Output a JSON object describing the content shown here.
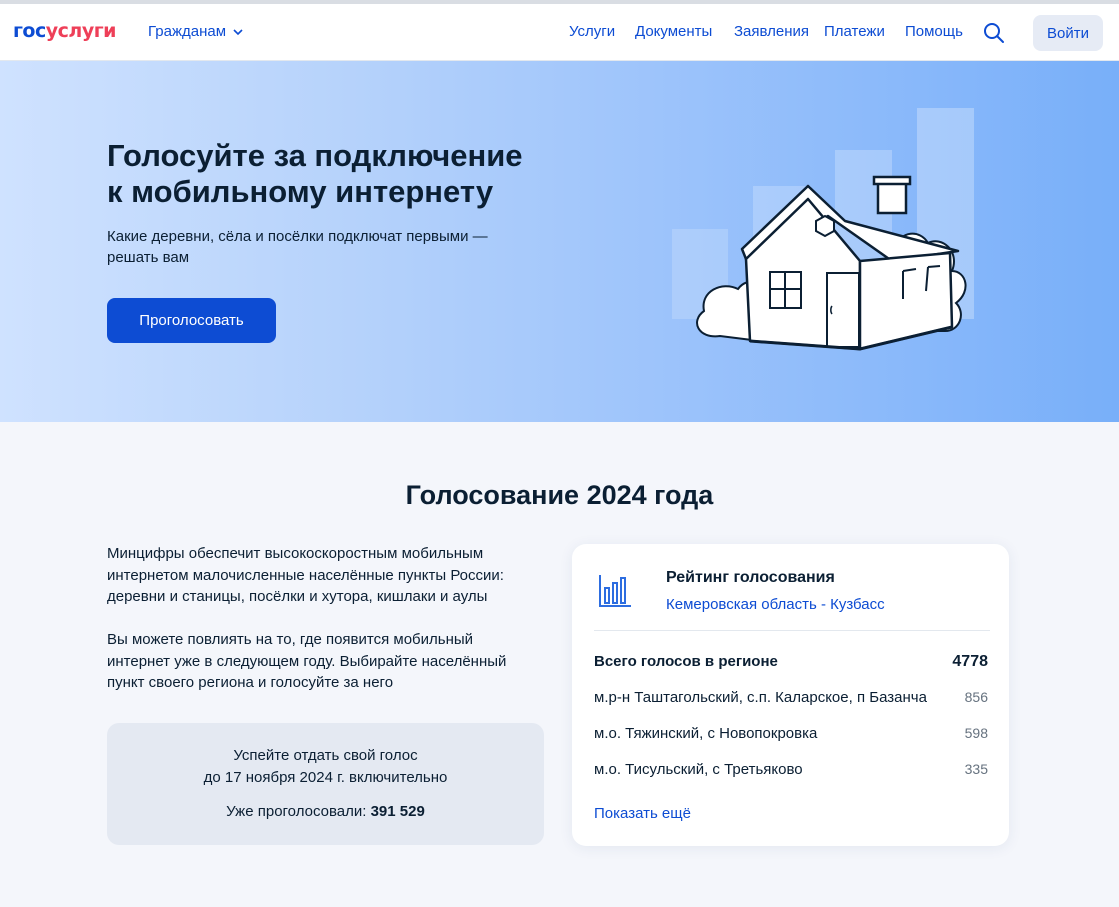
{
  "header": {
    "logo_part1": "гос",
    "logo_part2": "услуги",
    "citizens_label": "Гражданам",
    "nav": [
      "Услуги",
      "Документы",
      "Заявления",
      "Платежи",
      "Помощь"
    ],
    "search_icon": "search-icon",
    "login_label": "Войти"
  },
  "hero": {
    "title_line1": "Голосуйте за подключение",
    "title_line2": "к мобильному интернету",
    "subtitle_line1": "Какие деревни, сёла и посёлки подключат первыми —",
    "subtitle_line2": "решать вам",
    "button_label": "Проголосовать"
  },
  "section": {
    "title": "Голосование 2024 года",
    "paragraph1": [
      "Минцифры обеспечит высокоскоростным мобильным",
      "интернетом малочисленные населённые пункты России:",
      "деревни и станицы, посёлки и хутора, кишлаки и аулы"
    ],
    "paragraph2": [
      "Вы можете повлиять на то, где появится мобильный",
      "интернет уже в следующем году. Выбирайте населённый",
      "пункт своего региона и голосуйте за него"
    ],
    "deadline_line1": "Успейте отдать свой голос",
    "deadline_line2": "до 17 ноября 2024 г. включительно",
    "voted_label": "Уже проголосовали:",
    "voted_count": "391 529"
  },
  "rating": {
    "icon": "bar-chart-icon",
    "title": "Рейтинг голосования",
    "region": "Кемеровская область - Кузбасс",
    "total_label": "Всего голосов в регионе",
    "total_value": "4778",
    "items": [
      {
        "name": "м.р-н Таштагольский, с.п. Каларское, п Базанча",
        "votes": "856"
      },
      {
        "name": "м.о. Тяжинский, с Новопокровка",
        "votes": "598"
      },
      {
        "name": "м.о. Тисульский, с Третьяково",
        "votes": "335"
      }
    ],
    "more_label": "Показать ещё"
  },
  "colors": {
    "accent": "#0d4cd3",
    "logo_red": "#ee3f58",
    "text": "#0b1f33",
    "page_bg": "#f4f6fb"
  }
}
